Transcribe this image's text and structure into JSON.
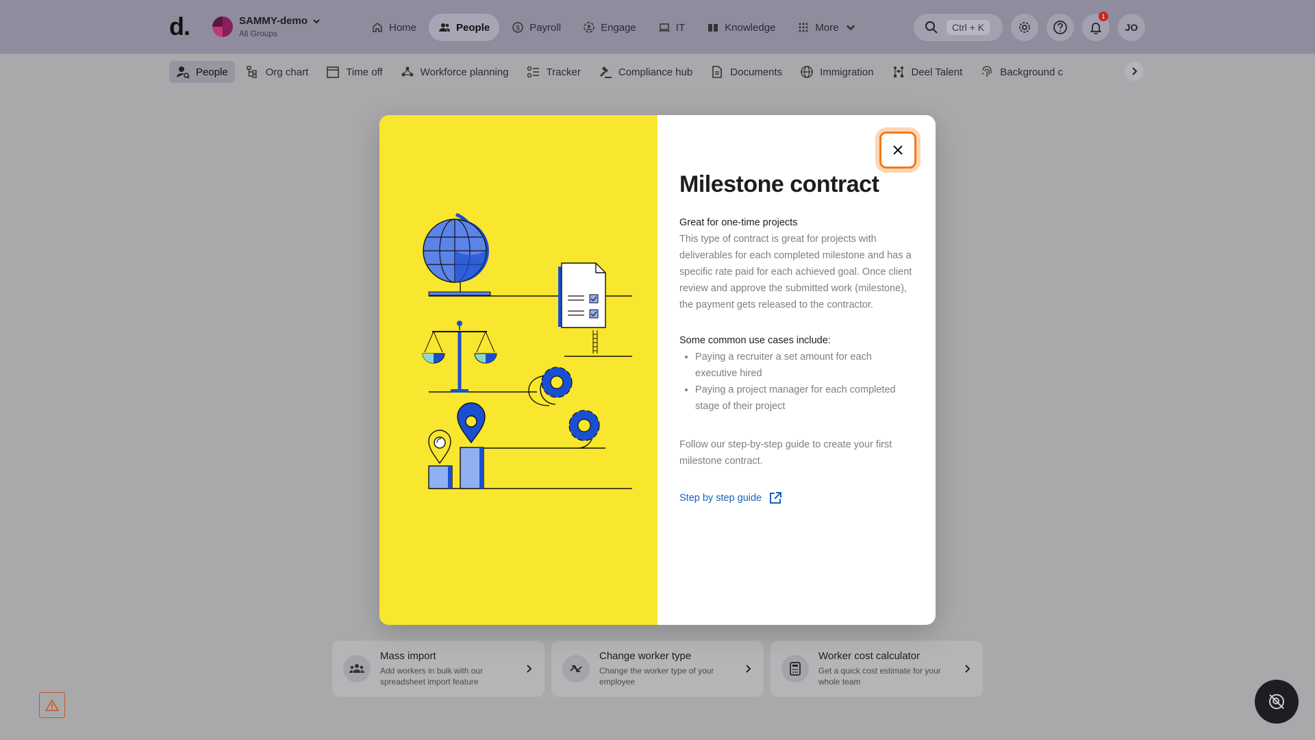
{
  "header": {
    "logo": "d.",
    "org_name": "SAMMY-demo",
    "org_sub": "All Groups",
    "nav": [
      {
        "label": "Home",
        "icon": "home-icon"
      },
      {
        "label": "People",
        "icon": "people-icon",
        "active": true
      },
      {
        "label": "Payroll",
        "icon": "dollar-icon"
      },
      {
        "label": "Engage",
        "icon": "engage-icon"
      },
      {
        "label": "IT",
        "icon": "laptop-icon"
      },
      {
        "label": "Knowledge",
        "icon": "book-icon"
      },
      {
        "label": "More",
        "icon": "grid-icon"
      }
    ],
    "search_shortcut": "Ctrl + K",
    "notification_count": "1",
    "user_initials": "JO"
  },
  "subnav": [
    {
      "label": "People",
      "active": true
    },
    {
      "label": "Org chart"
    },
    {
      "label": "Time off"
    },
    {
      "label": "Workforce planning"
    },
    {
      "label": "Tracker"
    },
    {
      "label": "Compliance hub"
    },
    {
      "label": "Documents"
    },
    {
      "label": "Immigration"
    },
    {
      "label": "Deel Talent"
    },
    {
      "label": "Background c"
    }
  ],
  "cards": [
    {
      "title": "Mass import",
      "desc": "Add workers in bulk with our spreadsheet import feature"
    },
    {
      "title": "Change worker type",
      "desc": "Change the worker type of your employee"
    },
    {
      "title": "Worker cost calculator",
      "desc": "Get a quick cost estimate for your whole team"
    }
  ],
  "modal": {
    "title": "Milestone contract",
    "subtitle": "Great for one-time projects",
    "body": "This type of contract is great for projects with deliverables for each completed milestone and has a specific rate paid for each achieved goal. Once client review and approve the submitted work (milestone), the payment gets released to the contractor.",
    "use_cases_title": "Some common use cases include:",
    "use_cases": [
      "Paying a recruiter a set amount for each executive hired",
      "Paying a project manager for each completed stage of their project"
    ],
    "follow_text": "Follow our step-by-step guide to create your first milestone contract.",
    "link_label": "Step by step guide",
    "colors": {
      "illustration_bg": "#f9e62e",
      "link": "#1560bd",
      "close_focus": "#f07a1a"
    }
  }
}
